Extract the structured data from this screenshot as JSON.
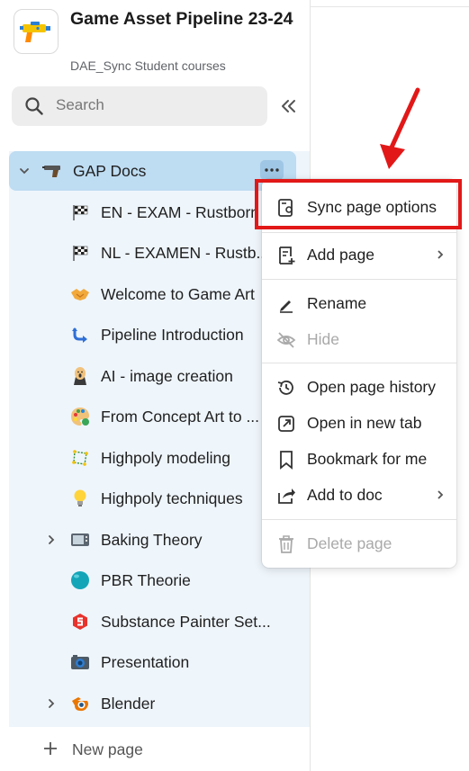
{
  "doc": {
    "title": "Game Asset Pipeline 23-24",
    "subtitle": "DAE_Sync Student courses",
    "icon": "toy-blaster-icon"
  },
  "search": {
    "placeholder": "Search"
  },
  "tree": {
    "parent": {
      "label": "GAP Docs",
      "icon": "pistol-icon"
    },
    "items": [
      {
        "label": "EN - EXAM - Rustborn",
        "icon": "chequered-flag-icon",
        "has_children": false
      },
      {
        "label": "NL - EXAMEN - Rustb...",
        "icon": "chequered-flag-icon",
        "has_children": false
      },
      {
        "label": "Welcome to Game Art",
        "icon": "handshake-icon",
        "has_children": false
      },
      {
        "label": "Pipeline Introduction",
        "icon": "curved-arrow-icon",
        "has_children": false
      },
      {
        "label": "AI - image creation",
        "icon": "scream-face-icon",
        "has_children": false
      },
      {
        "label": "From Concept Art to ...",
        "icon": "palette-icon",
        "has_children": false
      },
      {
        "label": "Highpoly modeling",
        "icon": "polygon-icon",
        "has_children": false
      },
      {
        "label": "Highpoly techniques",
        "icon": "light-bulb-icon",
        "has_children": false
      },
      {
        "label": "Baking Theory",
        "icon": "microwave-icon",
        "has_children": true
      },
      {
        "label": "PBR Theorie",
        "icon": "teal-sphere-icon",
        "has_children": false
      },
      {
        "label": "Substance Painter Set...",
        "icon": "substance-painter-icon",
        "has_children": false
      },
      {
        "label": "Presentation",
        "icon": "camera-icon",
        "has_children": false
      },
      {
        "label": "Blender",
        "icon": "blender-icon",
        "has_children": true
      }
    ]
  },
  "new_page": {
    "label": "New page"
  },
  "menu": {
    "items": [
      {
        "label": "Sync page options",
        "icon": "sync-settings-icon",
        "disabled": false,
        "submenu": false
      },
      {
        "label": "Add page",
        "icon": "add-page-icon",
        "disabled": false,
        "submenu": true
      },
      {
        "label": "Rename",
        "icon": "pencil-icon",
        "disabled": false,
        "submenu": false
      },
      {
        "label": "Hide",
        "icon": "eye-off-icon",
        "disabled": true,
        "submenu": false
      },
      {
        "label": "Open page history",
        "icon": "history-icon",
        "disabled": false,
        "submenu": false
      },
      {
        "label": "Open in new tab",
        "icon": "open-external-icon",
        "disabled": false,
        "submenu": false
      },
      {
        "label": "Bookmark for me",
        "icon": "bookmark-icon",
        "disabled": false,
        "submenu": false
      },
      {
        "label": "Add to doc",
        "icon": "share-arrow-icon",
        "disabled": false,
        "submenu": true
      },
      {
        "label": "Delete page",
        "icon": "trash-icon",
        "disabled": true,
        "submenu": false
      }
    ]
  },
  "colors": {
    "selected_row": "#bedcf2",
    "tree_background": "#eef5fb",
    "annotation_red": "#e21818"
  }
}
